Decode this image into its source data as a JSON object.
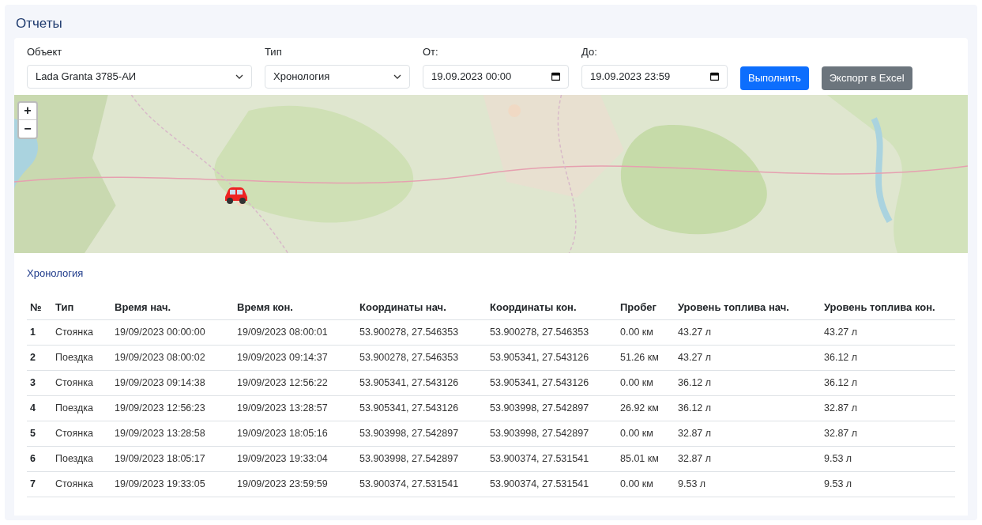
{
  "page_title": "Отчеты",
  "filters": {
    "object": {
      "label": "Объект",
      "value": "Lada Granta 3785-АИ"
    },
    "type": {
      "label": "Тип",
      "value": "Хронология"
    },
    "from": {
      "label": "От:",
      "value": "19.09.2023 00:00"
    },
    "to": {
      "label": "До:",
      "value": "19.09.2023 23:59"
    },
    "buttons": [
      {
        "label": "Выполнить",
        "kind": "primary"
      },
      {
        "label": "Экспорт в Excel",
        "kind": "secondary"
      }
    ]
  },
  "map": {
    "zoom_in": "+",
    "zoom_out": "−"
  },
  "report": {
    "title": "Хронология",
    "columns": [
      "№",
      "Тип",
      "Время нач.",
      "Время кон.",
      "Координаты нач.",
      "Координаты кон.",
      "Пробег",
      "Уровень топлива нач.",
      "Уровень топлива кон."
    ],
    "rows": [
      [
        "1",
        "Стоянка",
        "19/09/2023 00:00:00",
        "19/09/2023 08:00:01",
        "53.900278, 27.546353",
        "53.900278, 27.546353",
        "0.00 км",
        "43.27 л",
        "43.27 л"
      ],
      [
        "2",
        "Поездка",
        "19/09/2023 08:00:02",
        "19/09/2023 09:14:37",
        "53.900278, 27.546353",
        "53.905341, 27.543126",
        "51.26 км",
        "43.27 л",
        "36.12 л"
      ],
      [
        "3",
        "Стоянка",
        "19/09/2023 09:14:38",
        "19/09/2023 12:56:22",
        "53.905341, 27.543126",
        "53.905341, 27.543126",
        "0.00 км",
        "36.12 л",
        "36.12 л"
      ],
      [
        "4",
        "Поездка",
        "19/09/2023 12:56:23",
        "19/09/2023 13:28:57",
        "53.905341, 27.543126",
        "53.903998, 27.542897",
        "26.92 км",
        "36.12 л",
        "32.87 л"
      ],
      [
        "5",
        "Стоянка",
        "19/09/2023 13:28:58",
        "19/09/2023 18:05:16",
        "53.903998, 27.542897",
        "53.903998, 27.542897",
        "0.00 км",
        "32.87 л",
        "32.87 л"
      ],
      [
        "6",
        "Поездка",
        "19/09/2023 18:05:17",
        "19/09/2023 19:33:04",
        "53.903998, 27.542897",
        "53.900374, 27.531541",
        "85.01 км",
        "32.87 л",
        "9.53 л"
      ],
      [
        "7",
        "Стоянка",
        "19/09/2023 19:33:05",
        "19/09/2023 23:59:59",
        "53.900374, 27.531541",
        "53.900374, 27.531541",
        "0.00 км",
        "9.53 л",
        "9.53 л"
      ]
    ]
  }
}
